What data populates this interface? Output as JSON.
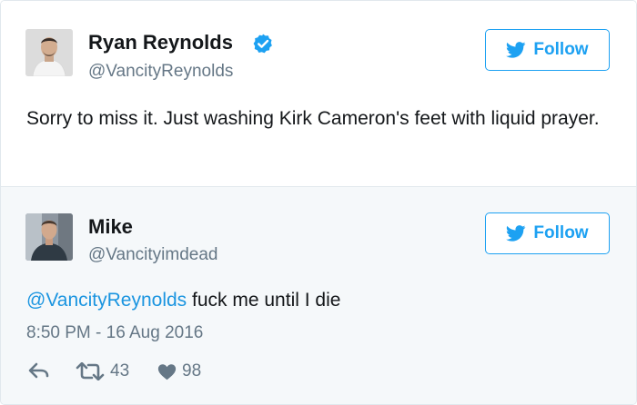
{
  "tweet": {
    "author": {
      "name": "Ryan Reynolds",
      "handle": "@VancityReynolds",
      "verified": true
    },
    "follow_label": "Follow",
    "text": "Sorry to miss it. Just washing Kirk Cameron's feet with liquid prayer."
  },
  "reply": {
    "author": {
      "name": "Mike",
      "handle": "@Vancityimdead"
    },
    "follow_label": "Follow",
    "mention": "@VancityReynolds",
    "text": " fuck me until I die",
    "timestamp": "8:50 PM - 16 Aug 2016",
    "actions": {
      "retweets": "43",
      "likes": "98"
    }
  },
  "icons": {
    "verified": "verified-badge-icon",
    "follow": "twitter-bird-icon",
    "reply": "reply-icon",
    "retweet": "retweet-icon",
    "like": "heart-icon"
  },
  "colors": {
    "accent": "#1da1f2",
    "mention": "#1b95e0",
    "muted": "#657786",
    "text": "#14171a",
    "reply_background": "#f5f8fa"
  }
}
